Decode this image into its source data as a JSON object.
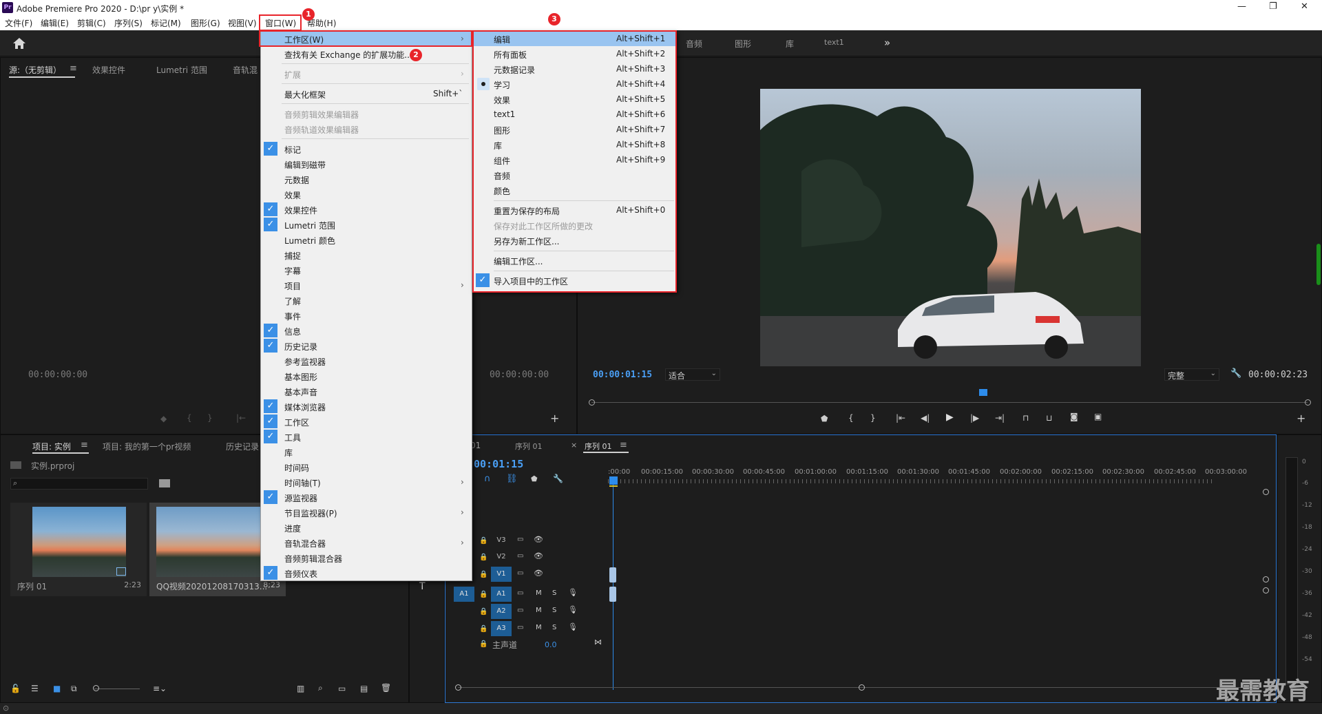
{
  "app": {
    "title": "Adobe Premiere Pro 2020 - D:\\pr y\\实例 *",
    "logo": "Pr",
    "window_controls": [
      "—",
      "❐",
      "✕"
    ]
  },
  "menubar": {
    "items": [
      "文件(F)",
      "编辑(E)",
      "剪辑(C)",
      "序列(S)",
      "标记(M)",
      "图形(G)",
      "视图(V)",
      "窗口(W)",
      "帮助(H)"
    ]
  },
  "workspace_tabs": [
    "音频",
    "图形",
    "库",
    "text1"
  ],
  "workspace_more": "»",
  "source_panel": {
    "tabs": [
      "源:（无剪辑）",
      "效果控件",
      "Lumetri 范围",
      "音轨混"
    ],
    "timecode": "00:00:00:00",
    "timecode_right": "00:00:00:00"
  },
  "program_panel": {
    "timecode_left": "00:00:01:15",
    "fit_select": "适合",
    "quality_select": "完整",
    "timecode_right": "00:00:02:23"
  },
  "project_panel": {
    "tabs": [
      "项目: 实例",
      "项目: 我的第一个pr视频",
      "历史记录"
    ],
    "project_file": "实例.prproj",
    "search_placeholder": "",
    "items": [
      {
        "name": "序列 01",
        "duration": "2:23"
      },
      {
        "name": "QQ视频20201208170313...",
        "duration": "8;23"
      }
    ]
  },
  "timeline": {
    "tabs": [
      "01",
      "序列 01",
      "序列 01"
    ],
    "timecode": "00:01:15",
    "ruler": [
      ":00:00",
      "00:00:15:00",
      "00:00:30:00",
      "00:00:45:00",
      "00:01:00:00",
      "00:01:15:00",
      "00:01:30:00",
      "00:01:45:00",
      "00:02:00:00",
      "00:02:15:00",
      "00:02:30:00",
      "00:02:45:00",
      "00:03:00:00"
    ],
    "video_tracks": [
      "V3",
      "V2",
      "V1"
    ],
    "audio_tracks": [
      "A1",
      "A2",
      "A3"
    ],
    "source_patch": "A1",
    "master_label": "主声道",
    "master_value": "0.0",
    "mute": "M",
    "solo": "S"
  },
  "vu_meter": {
    "scale": [
      "0",
      "-6",
      "-12",
      "-18",
      "-24",
      "-30",
      "-36",
      "-42",
      "-48",
      "-54"
    ]
  },
  "window_menu": {
    "items": [
      {
        "label": "工作区(W)",
        "submenu": true,
        "highlight": true
      },
      {
        "label": "查找有关 Exchange 的扩展功能..."
      },
      {
        "label": "扩展",
        "disabled": true,
        "submenu": true
      },
      {
        "label": "最大化框架",
        "shortcut": "Shift+`"
      },
      {
        "label": "音频剪辑效果编辑器",
        "disabled": true
      },
      {
        "label": "音频轨道效果编辑器",
        "disabled": true
      },
      {
        "label": "标记",
        "checked": true
      },
      {
        "label": "编辑到磁带"
      },
      {
        "label": "元数据"
      },
      {
        "label": "效果"
      },
      {
        "label": "效果控件",
        "checked": true
      },
      {
        "label": "Lumetri 范围",
        "checked": true
      },
      {
        "label": "Lumetri 颜色"
      },
      {
        "label": "捕捉"
      },
      {
        "label": "字幕"
      },
      {
        "label": "项目",
        "submenu": true
      },
      {
        "label": "了解"
      },
      {
        "label": "事件"
      },
      {
        "label": "信息",
        "checked": true
      },
      {
        "label": "历史记录",
        "checked": true
      },
      {
        "label": "参考监视器"
      },
      {
        "label": "基本图形"
      },
      {
        "label": "基本声音"
      },
      {
        "label": "媒体浏览器",
        "checked": true
      },
      {
        "label": "工作区",
        "checked": true
      },
      {
        "label": "工具",
        "checked": true
      },
      {
        "label": "库"
      },
      {
        "label": "时间码"
      },
      {
        "label": "时间轴(T)",
        "submenu": true
      },
      {
        "label": "源监视器",
        "checked": true
      },
      {
        "label": "节目监视器(P)",
        "submenu": true
      },
      {
        "label": "进度"
      },
      {
        "label": "音轨混合器",
        "submenu": true
      },
      {
        "label": "音频剪辑混合器"
      },
      {
        "label": "音频仪表",
        "checked": true
      }
    ]
  },
  "workspace_menu": {
    "items": [
      {
        "label": "编辑",
        "shortcut": "Alt+Shift+1",
        "highlight": true
      },
      {
        "label": "所有面板",
        "shortcut": "Alt+Shift+2"
      },
      {
        "label": "元数据记录",
        "shortcut": "Alt+Shift+3"
      },
      {
        "label": "学习",
        "shortcut": "Alt+Shift+4",
        "bullet": true
      },
      {
        "label": "效果",
        "shortcut": "Alt+Shift+5"
      },
      {
        "label": "text1",
        "shortcut": "Alt+Shift+6"
      },
      {
        "label": "图形",
        "shortcut": "Alt+Shift+7"
      },
      {
        "label": "库",
        "shortcut": "Alt+Shift+8"
      },
      {
        "label": "组件",
        "shortcut": "Alt+Shift+9"
      },
      {
        "label": "音频"
      },
      {
        "label": "颜色"
      },
      {
        "label": "重置为保存的布局",
        "shortcut": "Alt+Shift+0"
      },
      {
        "label": "保存对此工作区所做的更改",
        "disabled": true
      },
      {
        "label": "另存为新工作区..."
      },
      {
        "label": "编辑工作区..."
      },
      {
        "label": "导入项目中的工作区",
        "checked": true
      }
    ]
  },
  "annotations": [
    "1",
    "2",
    "3"
  ],
  "watermark": "最需教育",
  "colors": {
    "accent": "#3b90e6",
    "highlight": "#99c4f0",
    "annotation_red": "#e8242a",
    "timecode_blue": "#4a9ff5"
  }
}
